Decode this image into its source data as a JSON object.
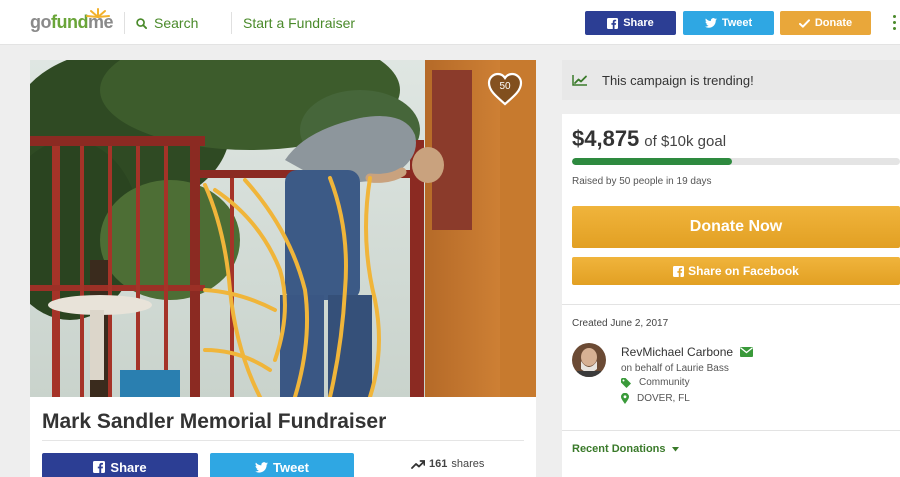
{
  "header": {
    "logo": {
      "go": "go",
      "fund": "fund",
      "me": "me"
    },
    "search_label": "Search",
    "start_label": "Start a Fundraiser",
    "share_label": "Share",
    "tweet_label": "Tweet",
    "donate_label": "Donate"
  },
  "campaign": {
    "title": "Mark Sandler Memorial Fundraiser",
    "heart_count": "50",
    "share_label": "Share",
    "tweet_label": "Tweet",
    "shares_count": "161",
    "shares_label": "shares"
  },
  "sidebar": {
    "trending_text": "This campaign is trending!",
    "raised_amount": "$4,875",
    "goal_text": "of $10k goal",
    "progress_fraction": 0.4875,
    "raised_by_text": "Raised by 50 people in 19 days",
    "donate_now_label": "Donate Now",
    "share_facebook_label": "Share on Facebook",
    "created_text": "Created June 2, 2017",
    "organizer_name": "RevMichael Carbone",
    "behalf_text": "on behalf of Laurie Bass",
    "category": "Community",
    "location": "DOVER, FL",
    "recent_donations_label": "Recent Donations"
  },
  "colors": {
    "brand_green": "#6aa539",
    "facebook_blue": "#2c3e94",
    "twitter_blue": "#2fa7e3",
    "donate_orange": "#e9a73a",
    "progress_green": "#2e8a3f"
  },
  "icons": [
    "search-icon",
    "facebook-icon",
    "twitter-icon",
    "checkmark-icon",
    "menu-icon",
    "heart-icon",
    "trending-icon",
    "email-icon",
    "tag-icon",
    "location-pin-icon",
    "caret-down-icon"
  ]
}
